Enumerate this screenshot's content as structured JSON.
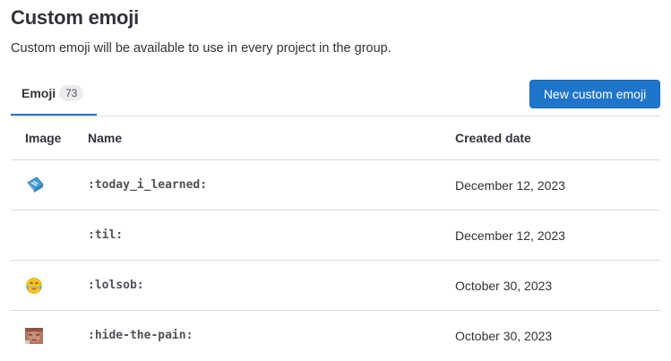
{
  "page": {
    "title": "Custom emoji",
    "description": "Custom emoji will be available to use in every project in the group."
  },
  "tabs": [
    {
      "label": "Emoji",
      "count": "73",
      "active": true
    }
  ],
  "actions": {
    "new_label": "New custom emoji"
  },
  "table": {
    "headers": {
      "image": "Image",
      "name": "Name",
      "created": "Created date"
    },
    "rows": [
      {
        "name": ":today_i_learned:",
        "created": "December 12, 2023",
        "image_icon": "blue-book-icon"
      },
      {
        "name": ":til:",
        "created": "December 12, 2023",
        "image_icon": ""
      },
      {
        "name": ":lolsob:",
        "created": "October 30, 2023",
        "image_icon": "crying-laughing-face-icon"
      },
      {
        "name": ":hide-the-pain:",
        "created": "October 30, 2023",
        "image_icon": "face-photo-icon"
      }
    ]
  },
  "colors": {
    "accent": "#1f75cb",
    "text": "#333238",
    "border": "#dcdcde"
  }
}
